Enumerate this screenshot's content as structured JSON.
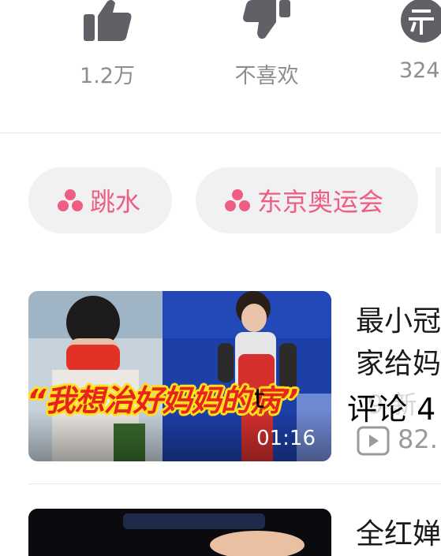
{
  "actions": {
    "like": {
      "count": "1.2万",
      "icon": "thumb-up-icon"
    },
    "dislike": {
      "label": "不喜欢",
      "icon": "thumb-down-icon"
    },
    "coin": {
      "count": "324",
      "icon": "coin-icon"
    }
  },
  "tags": [
    {
      "label": "跳水",
      "icon": "tag-dots-icon"
    },
    {
      "label": "东京奥运会",
      "icon": "tag-dots-icon"
    }
  ],
  "videos": [
    {
      "title_lines": [
        "最小冠",
        "家给妈"
      ],
      "overlay_caption": "“我想治好妈妈的病”",
      "duration": "01:16",
      "comment_overlay": "评论 4",
      "overlay_fragment": "t",
      "views": "82.",
      "meta_faded": "9 新"
    },
    {
      "title_lines": [
        "全红婵"
      ]
    }
  ],
  "colors": {
    "accent_pink": "#ee5d82",
    "icon_gray": "#5f6166",
    "chip_bg": "#f1f1f3",
    "caption_red": "#e8221c",
    "caption_yellow": "#ffe21a"
  }
}
